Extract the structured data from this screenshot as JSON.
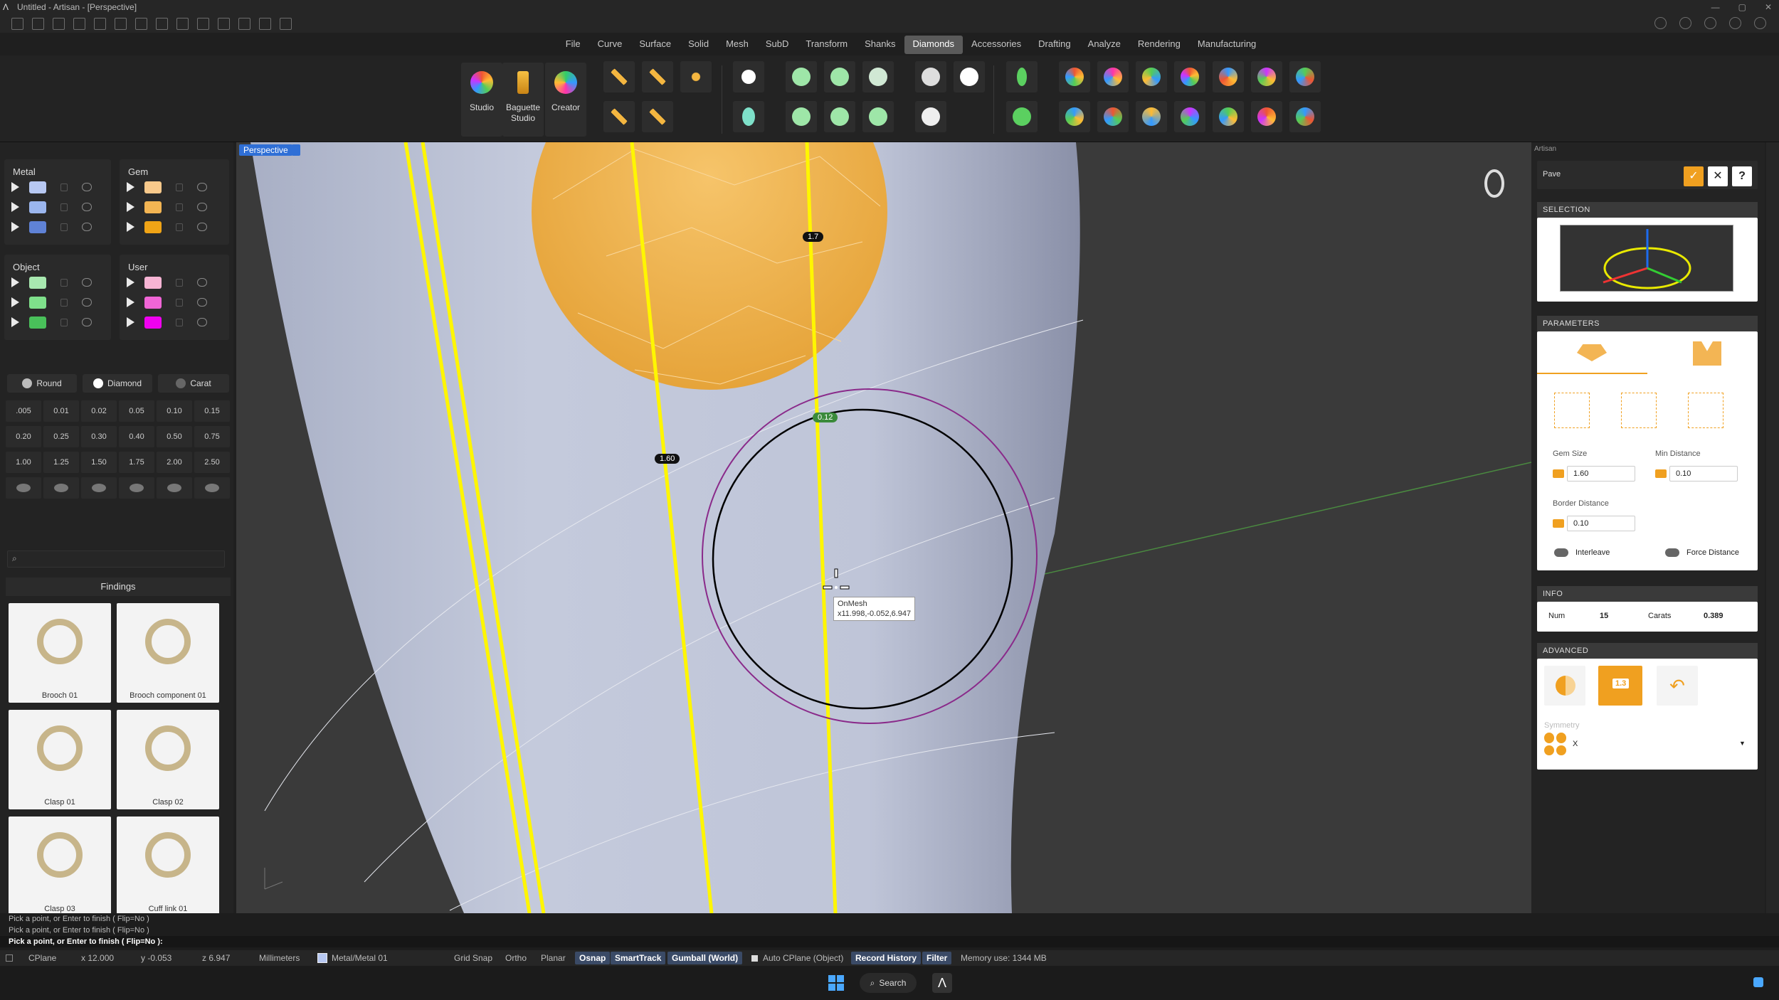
{
  "window": {
    "title": "Untitled - Artisan - [Perspective]"
  },
  "menu": {
    "tabs": [
      "File",
      "Curve",
      "Surface",
      "Solid",
      "Mesh",
      "SubD",
      "Transform",
      "Shanks",
      "Diamonds",
      "Accessories",
      "Drafting",
      "Analyze",
      "Rendering",
      "Manufacturing"
    ],
    "active": "Diamonds"
  },
  "ribbon": {
    "studio": "Studio",
    "baguette": "Baguette Studio",
    "creator": "Creator"
  },
  "layers": {
    "metal": "Metal",
    "gem": "Gem",
    "object": "Object",
    "user": "User",
    "colors": {
      "metal": [
        "#b7c8f2",
        "#9bb6ee",
        "#5f82d6"
      ],
      "gem": [
        "#f8c98b",
        "#f3b553",
        "#f0a416"
      ],
      "object": [
        "#a8e8b0",
        "#7fe08b",
        "#49c05a"
      ],
      "user": [
        "#f7b4d4",
        "#f065d6",
        "#f000f0"
      ]
    }
  },
  "gem_selector": {
    "shape": "Round",
    "type": "Diamond",
    "unit": "Carat"
  },
  "sizes": [
    ".005",
    "0.01",
    "0.02",
    "0.05",
    "0.10",
    "0.15",
    "0.20",
    "0.25",
    "0.30",
    "0.40",
    "0.50",
    "0.75",
    "1.00",
    "1.25",
    "1.50",
    "1.75",
    "2.00",
    "2.50"
  ],
  "findings": {
    "title": "Findings",
    "items": [
      "Brooch 01",
      "Brooch component 01",
      "Clasp 01",
      "Clasp 02",
      "Clasp 03",
      "Cuff link 01"
    ]
  },
  "viewport": {
    "label": "Perspective",
    "dim_top": "1.7",
    "dim_small": "0.12",
    "dim_side": "1.60",
    "tooltip_title": "OnMesh",
    "tooltip_coords": "x11.998,-0.052,6.947"
  },
  "artisan": {
    "panel_label": "Artisan",
    "command": "Pave",
    "selection": "SELECTION",
    "parameters": "PARAMETERS",
    "gem_size_label": "Gem Size",
    "gem_size": "1.60",
    "min_distance_label": "Min Distance",
    "min_distance": "0.10",
    "border_distance_label": "Border Distance",
    "border_distance": "0.10",
    "interleave": "Interleave",
    "force_distance": "Force Distance",
    "info": "INFO",
    "num_label": "Num",
    "num": "15",
    "carats_label": "Carats",
    "carats": "0.389",
    "advanced": "ADVANCED",
    "advanced_badge": "1.3",
    "symmetry_label": "Symmetry",
    "symmetry": "X"
  },
  "command_history": [
    "Pick a point, or Enter to finish ( Flip=No )",
    "Pick a point, or Enter to finish ( Flip=No )",
    "Pick a point, or Enter to finish ( Flip=No ):"
  ],
  "status": {
    "cplane": "CPlane",
    "x": "x 12.000",
    "y": "y -0.053",
    "z": "z 6.947",
    "units": "Millimeters",
    "layer": "Metal/Metal 01",
    "grid_snap": "Grid Snap",
    "ortho": "Ortho",
    "planar": "Planar",
    "osnap": "Osnap",
    "smarttrack": "SmartTrack",
    "gumball": "Gumball (World)",
    "auto_cplane": "Auto CPlane (Object)",
    "record_history": "Record History",
    "filter": "Filter",
    "memory": "Memory use: 1344 MB"
  },
  "taskbar": {
    "search": "Search"
  }
}
